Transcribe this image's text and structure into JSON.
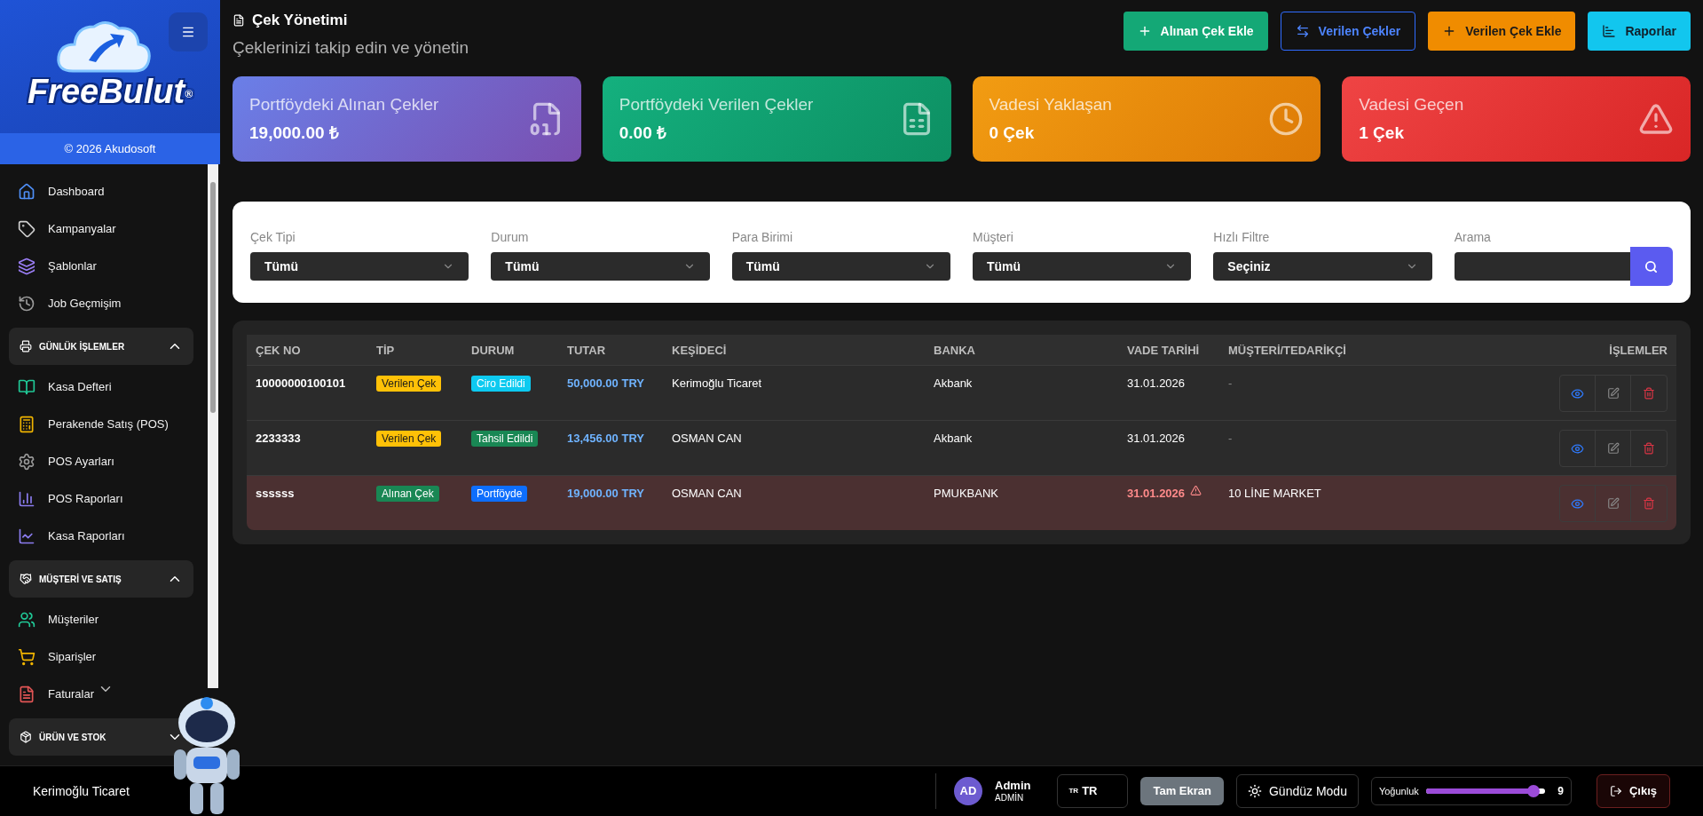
{
  "sidebar": {
    "brand": "FreeBulut",
    "brand_mark": "®",
    "copyright": "© 2026 Akudosoft",
    "items": [
      {
        "label": "Dashboard"
      },
      {
        "label": "Kampanyalar"
      },
      {
        "label": "Şablonlar"
      },
      {
        "label": "Job Geçmişim"
      }
    ],
    "sections": [
      {
        "title": "GÜNLÜK İŞLEMLER",
        "expanded": true,
        "items": [
          {
            "label": "Kasa Defteri",
            "submenu": false
          },
          {
            "label": "Perakende Satış (POS)",
            "submenu": false
          },
          {
            "label": "POS Ayarları",
            "submenu": false
          },
          {
            "label": "POS Raporları",
            "submenu": false
          },
          {
            "label": "Kasa Raporları",
            "submenu": false
          }
        ]
      },
      {
        "title": "MÜŞTERİ VE SATIŞ",
        "expanded": true,
        "items": [
          {
            "label": "Müşteriler",
            "submenu": false
          },
          {
            "label": "Siparişler",
            "submenu": false
          },
          {
            "label": "Faturalar",
            "submenu": true
          }
        ]
      },
      {
        "title": "ÜRÜN VE STOK",
        "expanded": false
      }
    ]
  },
  "header": {
    "title": "Çek Yönetimi",
    "subtitle": "Çeklerinizi takip edin ve yönetin",
    "buttons": [
      {
        "label": "Alınan Çek Ekle",
        "kind": "success"
      },
      {
        "label": "Verilen Çekler",
        "kind": "outline"
      },
      {
        "label": "Verilen Çek Ekle",
        "kind": "warning"
      },
      {
        "label": "Raporlar",
        "kind": "info"
      }
    ]
  },
  "stats": [
    {
      "label": "Portföydeki Alınan Çekler",
      "value": "19,000.00 ₺"
    },
    {
      "label": "Portföydeki Verilen Çekler",
      "value": "0.00 ₺"
    },
    {
      "label": "Vadesi Yaklaşan",
      "value": "0 Çek"
    },
    {
      "label": "Vadesi Geçen",
      "value": "1 Çek"
    }
  ],
  "filters": [
    {
      "label": "Çek Tipi",
      "value": "Tümü"
    },
    {
      "label": "Durum",
      "value": "Tümü"
    },
    {
      "label": "Para Birimi",
      "value": "Tümü"
    },
    {
      "label": "Müşteri",
      "value": "Tümü"
    },
    {
      "label": "Hızlı Filtre",
      "value": "Seçiniz"
    }
  ],
  "search": {
    "label": "Arama"
  },
  "table": {
    "columns": [
      "ÇEK NO",
      "TİP",
      "DURUM",
      "TUTAR",
      "KEŞİDECİ",
      "BANKA",
      "VADE TARİHİ",
      "MÜŞTERİ/TEDARİKÇİ",
      "İŞLEMLER"
    ],
    "rows": [
      {
        "no": "10000000100101",
        "type": {
          "text": "Verilen Çek",
          "color": "#ffc107"
        },
        "status": {
          "text": "Ciro Edildi",
          "color": "#0dcaf0"
        },
        "amount": "50,000.00 TRY",
        "drawer": "Kerimoğlu Ticaret",
        "bank": "Akbank",
        "due": "31.01.2026",
        "customer": "-",
        "overdue": false
      },
      {
        "no": "2233333",
        "type": {
          "text": "Verilen Çek",
          "color": "#ffc107"
        },
        "status": {
          "text": "Tahsil Edildi",
          "color": "#198754"
        },
        "amount": "13,456.00 TRY",
        "drawer": "OSMAN CAN",
        "bank": "Akbank",
        "due": "31.01.2026",
        "customer": "-",
        "overdue": false
      },
      {
        "no": "ssssss",
        "type": {
          "text": "Alınan Çek",
          "color": "#198754"
        },
        "status": {
          "text": "Portföyde",
          "color": "#0d6efd"
        },
        "amount": "19,000.00 TRY",
        "drawer": "OSMAN CAN",
        "bank": "PMUKBANK",
        "due": "31.01.2026",
        "customer": "10 LİNE MARKET",
        "overdue": true
      }
    ]
  },
  "footer": {
    "company": "Kerimoğlu Ticaret",
    "avatar": "AD",
    "user": "Admin",
    "role": "ADMİN",
    "lang_flag": "TR",
    "lang": "TR",
    "fullscreen": "Tam Ekran",
    "theme": "Gündüz Modu",
    "density": {
      "label": "Yoğunluk",
      "level": 0.9,
      "reading": "9"
    },
    "logout": "Çıkış"
  }
}
